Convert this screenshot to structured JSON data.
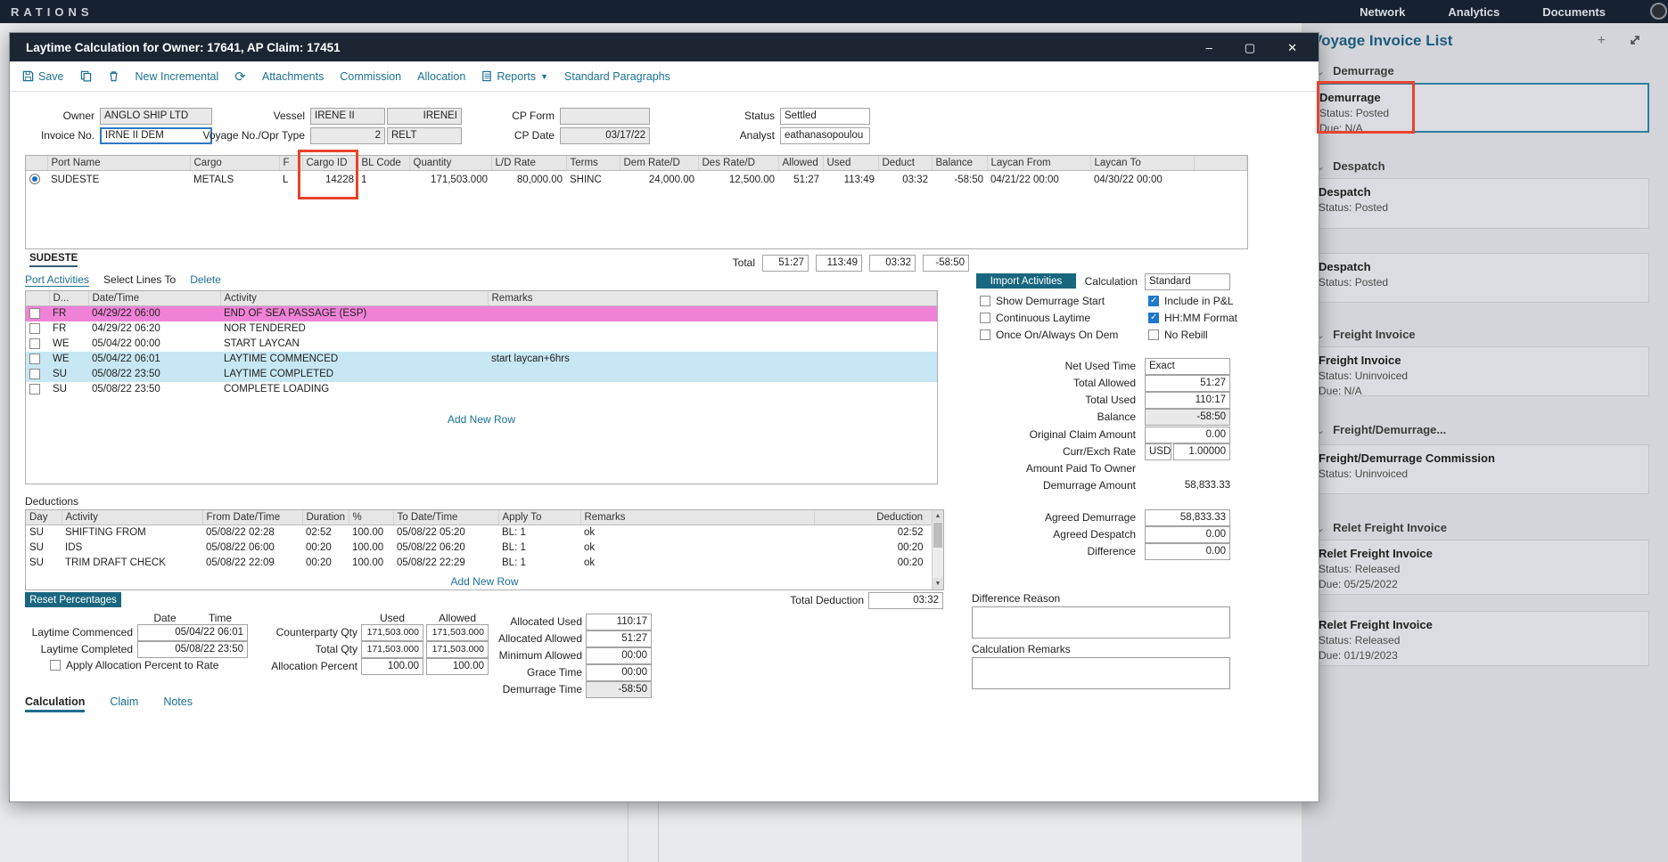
{
  "topbar": {
    "brand": "RATIONS",
    "nav": [
      "Network",
      "Analytics",
      "Documents"
    ]
  },
  "modal": {
    "title": "Laytime Calculation for Owner: 17641, AP Claim: 17451",
    "toolbar": {
      "save": "Save",
      "new_incremental": "New Incremental",
      "attachments": "Attachments",
      "commission": "Commission",
      "allocation": "Allocation",
      "reports": "Reports",
      "standard_paragraphs": "Standard Paragraphs"
    },
    "fields": {
      "owner_label": "Owner",
      "owner": "ANGLO SHIP LTD",
      "invoice_label": "Invoice No.",
      "invoice": "IRNE II DEM",
      "vessel_label": "Vessel",
      "vessel": "IRENE II",
      "vessel_code": "IRENEI",
      "voyage_label": "Voyage No./Opr Type",
      "voyage_no": "2",
      "opr_type": "RELT",
      "cp_form_label": "CP Form",
      "cp_form": "",
      "cp_date_label": "CP Date",
      "cp_date": "03/17/22",
      "status_label": "Status",
      "status": "Settled",
      "analyst_label": "Analyst",
      "analyst": "eathanasopoulou"
    },
    "cargo_grid": {
      "columns": [
        "Port Name",
        "Cargo",
        "F",
        "Cargo ID",
        "BL Code",
        "Quantity",
        "L/D Rate",
        "Terms",
        "Dem Rate/D",
        "Des Rate/D",
        "Allowed",
        "Used",
        "Deduct",
        "Balance",
        "Laycan From",
        "Laycan To"
      ],
      "row": {
        "port": "SUDESTE",
        "cargo": "METALS",
        "f": "L",
        "cargo_id": "14228",
        "bl": "1",
        "qty": "171,503.000",
        "ld_rate": "80,000.00",
        "terms": "SHINC",
        "dem_rate": "24,000.00",
        "des_rate": "12,500.00",
        "allowed": "51:27",
        "used": "113:49",
        "deduct": "03:32",
        "balance": "-58:50",
        "laycan_from": "04/21/22 00:00",
        "laycan_to": "04/30/22 00:00"
      }
    },
    "port_tab": "SUDESTE",
    "totals": {
      "label": "Total",
      "allowed": "51:27",
      "used": "113:49",
      "deduct": "03:32",
      "balance": "-58:50"
    },
    "activities": {
      "tab": "Port Activities",
      "select_lines": "Select Lines To",
      "delete_link": "Delete",
      "columns": [
        "D...",
        "Date/Time",
        "Activity",
        "Remarks"
      ],
      "rows": [
        {
          "day": "FR",
          "dt": "04/29/22 06:00",
          "activity": "END OF SEA PASSAGE (ESP)",
          "remarks": ""
        },
        {
          "day": "FR",
          "dt": "04/29/22 06:20",
          "activity": "NOR TENDERED",
          "remarks": ""
        },
        {
          "day": "WE",
          "dt": "05/04/22 00:00",
          "activity": "START LAYCAN",
          "remarks": ""
        },
        {
          "day": "WE",
          "dt": "05/04/22 06:01",
          "activity": "LAYTIME COMMENCED",
          "remarks": "start laycan+6hrs"
        },
        {
          "day": "SU",
          "dt": "05/08/22 23:50",
          "activity": "LAYTIME COMPLETED",
          "remarks": ""
        },
        {
          "day": "SU",
          "dt": "05/08/22 23:50",
          "activity": "COMPLETE LOADING",
          "remarks": ""
        }
      ],
      "add_new_row": "Add New Row"
    },
    "calc": {
      "import_btn": "Import Activities",
      "calculation_label": "Calculation",
      "calculation": "Standard",
      "cb_left": [
        "Show Demurrage Start",
        "Continuous Laytime",
        "Once On/Always On Dem"
      ],
      "cb_right": [
        "Include in P&L",
        "HH:MM Format",
        "No Rebill"
      ],
      "net_used_label": "Net Used Time",
      "net_used": "Exact",
      "total_allowed_label": "Total Allowed",
      "total_allowed": "51:27",
      "total_used_label": "Total Used",
      "total_used": "110:17",
      "balance_label": "Balance",
      "balance": "-58:50",
      "orig_claim_label": "Original Claim Amount",
      "orig_claim": "0.00",
      "curr_label": "Curr/Exch Rate",
      "curr": "USD",
      "exch_rate": "1.00000",
      "amount_paid_label": "Amount Paid To Owner",
      "dem_amount_label": "Demurrage Amount",
      "dem_amount": "58,833.33",
      "agreed_dem_label": "Agreed Demurrage",
      "agreed_dem": "58,833.33",
      "agreed_des_label": "Agreed Despatch",
      "agreed_des": "0.00",
      "difference_label": "Difference",
      "difference": "0.00"
    },
    "deductions": {
      "title": "Deductions",
      "columns": [
        "Day",
        "Activity",
        "From Date/Time",
        "Duration",
        "%",
        "To Date/Time",
        "Apply To",
        "Remarks",
        "Deduction"
      ],
      "rows": [
        {
          "day": "SU",
          "activity": "SHIFTING FROM",
          "from": "05/08/22 02:28",
          "duration": "02:52",
          "pct": "100.00",
          "to": "05/08/22 05:20",
          "apply": "BL: 1",
          "remarks": "ok",
          "deduction": "02:52"
        },
        {
          "day": "SU",
          "activity": "IDS",
          "from": "05/08/22 06:00",
          "duration": "00:20",
          "pct": "100.00",
          "to": "05/08/22 06:20",
          "apply": "BL: 1",
          "remarks": "ok",
          "deduction": "00:20"
        },
        {
          "day": "SU",
          "activity": "TRIM DRAFT CHECK",
          "from": "05/08/22 22:09",
          "duration": "00:20",
          "pct": "100.00",
          "to": "05/08/22 22:29",
          "apply": "BL: 1",
          "remarks": "ok",
          "deduction": "00:20"
        }
      ],
      "add_new_row": "Add New Row",
      "total_label": "Total Deduction",
      "total": "03:32"
    },
    "allocation": {
      "reset_btn": "Reset Percentages",
      "date_h": "Date",
      "time_h": "Time",
      "commenced_label": "Laytime Commenced",
      "commenced": "05/04/22 06:01",
      "completed_label": "Laytime Completed",
      "completed": "05/08/22 23:50",
      "apply_cb": "Apply Allocation Percent to Rate",
      "used_h": "Used",
      "allowed_h": "Allowed",
      "cp_qty_label": "Counterparty Qty",
      "cp_qty_used": "171,503.000",
      "cp_qty_allowed": "171,503.000",
      "total_qty_label": "Total Qty",
      "total_qty_used": "171,503.000",
      "total_qty_allowed": "171,503.000",
      "alloc_pct_label": "Allocation Percent",
      "alloc_pct_used": "100.00",
      "alloc_pct_allowed": "100.00",
      "alloc_used_label": "Allocated Used",
      "alloc_used": "110:17",
      "alloc_allowed_label": "Allocated Allowed",
      "alloc_allowed": "51:27",
      "min_allowed_label": "Minimum Allowed",
      "min_allowed": "00:00",
      "grace_label": "Grace Time",
      "grace": "00:00",
      "dem_time_label": "Demurrage Time",
      "dem_time": "-58:50"
    },
    "remarks": {
      "diff_reason_label": "Difference Reason",
      "calc_remarks_label": "Calculation Remarks"
    },
    "tabs": [
      "Calculation",
      "Claim",
      "Notes"
    ]
  },
  "panel": {
    "title": "Voyage Invoice List",
    "sections": [
      {
        "name": "Demurrage",
        "cards": [
          {
            "title": "Demurrage",
            "status": "Status: Posted",
            "due": "Due: N/A"
          }
        ]
      },
      {
        "name": "Despatch",
        "cards": [
          {
            "title": "Despatch",
            "status": "Status: Posted",
            "due": ""
          },
          {
            "title": "Despatch",
            "status": "Status: Posted",
            "due": ""
          }
        ]
      },
      {
        "name": "Freight Invoice",
        "cards": [
          {
            "title": "Freight Invoice",
            "status": "Status: Uninvoiced",
            "due": "Due: N/A"
          }
        ]
      },
      {
        "name": "Freight/Demurrage...",
        "cards": [
          {
            "title": "Freight/Demurrage Commission",
            "status": "Status: Uninvoiced",
            "due": ""
          }
        ]
      },
      {
        "name": "Relet Freight Invoice",
        "cards": [
          {
            "title": "Relet Freight Invoice",
            "status": "Status: Released",
            "due": "Due: 05/25/2022"
          },
          {
            "title": "Relet Freight Invoice",
            "status": "Status: Released",
            "due": "Due: 01/19/2023"
          }
        ]
      }
    ]
  }
}
